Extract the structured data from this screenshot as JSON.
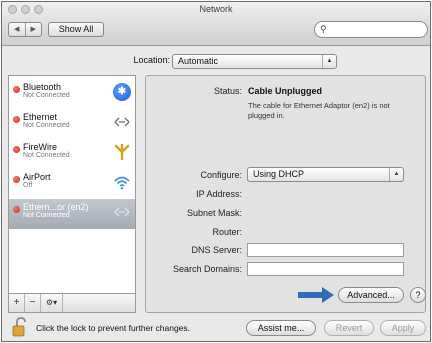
{
  "window": {
    "title": "Network"
  },
  "toolbar": {
    "back": "◀",
    "forward": "▶",
    "show_all_label": "Show All",
    "search_value": ""
  },
  "location": {
    "label": "Location:",
    "value": "Automatic"
  },
  "services": [
    {
      "name": "Bluetooth",
      "status": "Not Connected",
      "icon": "bluetooth-icon"
    },
    {
      "name": "Ethernet",
      "status": "Not Connected",
      "icon": "ethernet-icon"
    },
    {
      "name": "FireWire",
      "status": "Not Connected",
      "icon": "firewire-icon"
    },
    {
      "name": "AirPort",
      "status": "Off",
      "icon": "airport-icon"
    },
    {
      "name": "Ethern...or (en2)",
      "status": "Not Connected",
      "icon": "ethernet-icon",
      "selected": true
    }
  ],
  "sidebar_footer": {
    "add": "+",
    "remove": "−",
    "action": "⚙▾"
  },
  "detail": {
    "status_label": "Status:",
    "status_value": "Cable Unplugged",
    "status_desc_line1": "The cable for Ethernet Adaptor (en2) is not",
    "status_desc_line2": "plugged in.",
    "configure_label": "Configure:",
    "configure_value": "Using DHCP",
    "ip_label": "IP Address:",
    "subnet_label": "Subnet Mask:",
    "router_label": "Router:",
    "dns_label": "DNS Server:",
    "search_domains_label": "Search Domains:",
    "dns_value": "",
    "search_domains_value": ""
  },
  "advanced_label": "Advanced...",
  "help_label": "?",
  "bottom": {
    "lock_text": "Click the lock to prevent further changes.",
    "assist_label": "Assist me...",
    "revert_label": "Revert",
    "apply_label": "Apply"
  },
  "colors": {
    "annotation_arrow": "#2f6db8",
    "status_dot": "#d33a2e",
    "selection": "#a9afb9"
  }
}
